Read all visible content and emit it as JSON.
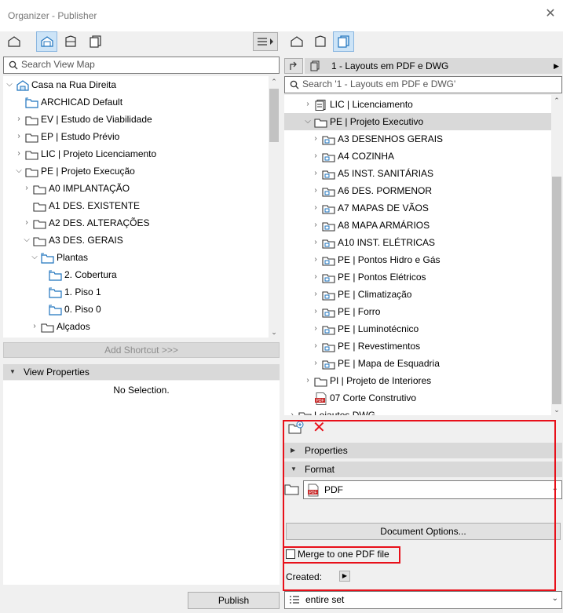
{
  "window": {
    "title": "Organizer - Publisher",
    "close_glyph": "✕"
  },
  "left": {
    "search_placeholder": "Search View Map",
    "tree": [
      {
        "label": "Casa na Rua Direita",
        "icon": "project-icon",
        "chev": "⌵"
      },
      {
        "label": "ARCHICAD Default",
        "icon": "view-folder-icon",
        "chev": ""
      },
      {
        "label": "EV | Estudo de Viabilidade",
        "icon": "folder-icon",
        "chev": "›"
      },
      {
        "label": "EP | Estudo Prévio",
        "icon": "folder-icon",
        "chev": "›"
      },
      {
        "label": "LIC | Projeto Licenciamento",
        "icon": "folder-icon",
        "chev": "›"
      },
      {
        "label": "PE | Projeto Execução",
        "icon": "folder-icon",
        "chev": "⌵"
      },
      {
        "label": "A0 IMPLANTAÇÃO",
        "icon": "folder-icon",
        "chev": "›"
      },
      {
        "label": "A1 DES. EXISTENTE",
        "icon": "folder-icon",
        "chev": ""
      },
      {
        "label": "A2 DES. ALTERAÇÕES",
        "icon": "folder-icon",
        "chev": "›"
      },
      {
        "label": "A3 DES. GERAIS",
        "icon": "folder-icon",
        "chev": "⌵"
      },
      {
        "label": "Plantas",
        "icon": "view-folder-icon",
        "chev": "⌵"
      },
      {
        "label": "2. Cobertura",
        "icon": "view-folder-icon",
        "chev": ""
      },
      {
        "label": "1. Piso 1",
        "icon": "view-folder-icon",
        "chev": ""
      },
      {
        "label": "0. Piso 0",
        "icon": "view-folder-icon",
        "chev": ""
      },
      {
        "label": "Alçados",
        "icon": "folder-icon",
        "chev": "›"
      }
    ],
    "add_shortcut": "Add Shortcut >>>",
    "view_properties": "View Properties",
    "no_selection": "No Selection.",
    "publish": "Publish"
  },
  "right": {
    "set_name": "1 - Layouts em PDF e DWG",
    "search_placeholder": "Search '1 - Layouts em PDF e DWG'",
    "tree": [
      {
        "label": "LIC | Licenciamento",
        "icon": "layout-book-icon",
        "chev": "›"
      },
      {
        "label": "PE | Projeto Executivo",
        "icon": "folder-icon",
        "chev": "⌵"
      },
      {
        "label": "A3 DESENHOS GERAIS",
        "icon": "layout-folder-icon",
        "chev": "›"
      },
      {
        "label": "A4 COZINHA",
        "icon": "layout-folder-icon",
        "chev": "›"
      },
      {
        "label": "A5 INST. SANITÁRIAS",
        "icon": "layout-folder-icon",
        "chev": "›"
      },
      {
        "label": "A6 DES. PORMENOR",
        "icon": "layout-folder-icon",
        "chev": "›"
      },
      {
        "label": "A7 MAPAS DE VÃOS",
        "icon": "layout-folder-icon",
        "chev": "›"
      },
      {
        "label": "A8 MAPA ARMÁRIOS",
        "icon": "layout-folder-icon",
        "chev": "›"
      },
      {
        "label": "A10 INST. ELÉTRICAS",
        "icon": "layout-folder-icon",
        "chev": "›"
      },
      {
        "label": "PE | Pontos Hidro e Gás",
        "icon": "layout-folder-icon",
        "chev": "›"
      },
      {
        "label": "PE | Pontos Elétricos",
        "icon": "layout-folder-icon",
        "chev": "›"
      },
      {
        "label": "PE | Climatização",
        "icon": "layout-folder-icon",
        "chev": "›"
      },
      {
        "label": "PE | Forro",
        "icon": "layout-folder-icon",
        "chev": "›"
      },
      {
        "label": "PE | Luminotécnico",
        "icon": "layout-folder-icon",
        "chev": "›"
      },
      {
        "label": "PE | Revestimentos",
        "icon": "layout-folder-icon",
        "chev": "›"
      },
      {
        "label": "PE | Mapa de Esquadria",
        "icon": "layout-folder-icon",
        "chev": "›"
      },
      {
        "label": "PI | Projeto de Interiores",
        "icon": "folder-icon",
        "chev": "›"
      },
      {
        "label": "07 Corte Construtivo",
        "icon": "pdf-icon",
        "chev": ""
      },
      {
        "label": "Leiautes DWG",
        "icon": "folder-icon",
        "chev": "›"
      }
    ],
    "properties": "Properties",
    "format": "Format",
    "format_value": "PDF",
    "pdf_badge": "PDF",
    "document_options": "Document Options...",
    "merge_label": "Merge to one PDF file",
    "created_label": "Created:",
    "entire_set": "entire set"
  },
  "colors": {
    "highlight": "#e8101a",
    "selected_row": "#d9d9d9",
    "icon_blue": "#1e73be",
    "pdf_red": "#c62828"
  }
}
